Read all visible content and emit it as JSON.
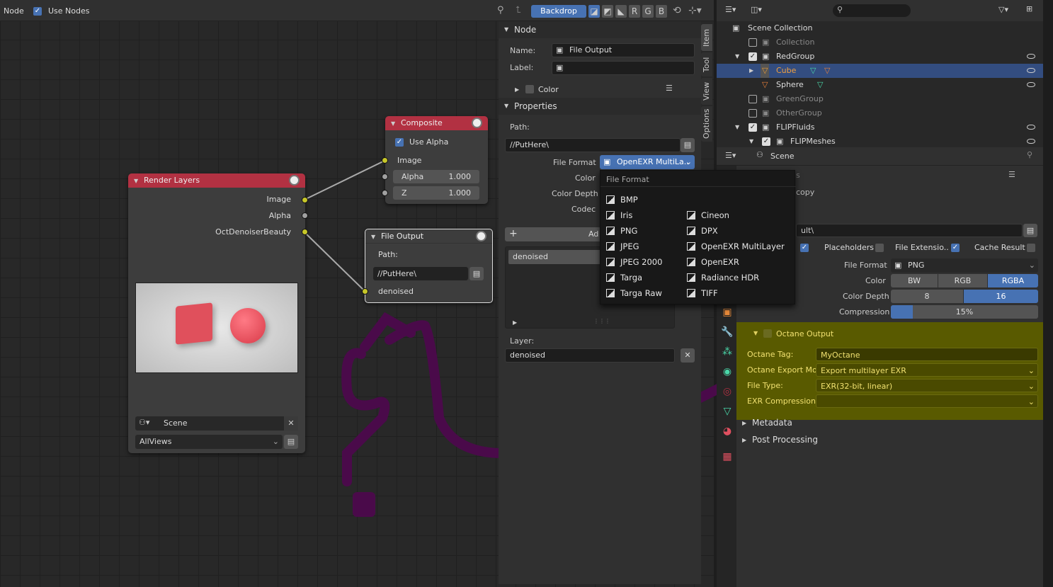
{
  "header": {
    "editor": "Node",
    "use_nodes": "Use Nodes",
    "backdrop": "Backdrop",
    "channels": [
      "R",
      "G",
      "B"
    ]
  },
  "render_layers": {
    "title": "Render Layers",
    "outputs": [
      "Image",
      "Alpha",
      "OctDenoiserBeauty"
    ],
    "scene": "Scene",
    "views": "AllViews"
  },
  "composite": {
    "title": "Composite",
    "use_alpha": "Use Alpha",
    "image": "Image",
    "alpha_label": "Alpha",
    "alpha_value": "1.000",
    "z_label": "Z",
    "z_value": "1.000"
  },
  "file_output_node": {
    "title": "File Output",
    "path_label": "Path:",
    "path": "//PutHere\\",
    "input": "denoised"
  },
  "npanel": {
    "node_section": "Node",
    "name_label": "Name:",
    "name_value": "File Output",
    "label_label": "Label:",
    "color_label": "Color",
    "properties_section": "Properties",
    "path_label": "Path:",
    "path": "//PutHere\\",
    "file_format_label": "File Format",
    "file_format_value": "OpenEXR MultiLa..",
    "color_label2": "Color",
    "color_depth_label": "Color Depth",
    "codec_label": "Codec",
    "add_input": "Ad",
    "slot": "denoised",
    "layer_label": "Layer:",
    "layer_value": "denoised",
    "tabs": [
      "Item",
      "Tool",
      "View",
      "Options"
    ]
  },
  "menu": {
    "title": "File Format",
    "left": [
      "BMP",
      "Iris",
      "PNG",
      "JPEG",
      "JPEG 2000",
      "Targa",
      "Targa Raw"
    ],
    "right": [
      "Cineon",
      "DPX",
      "OpenEXR MultiLayer",
      "OpenEXR",
      "Radiance HDR",
      "TIFF"
    ]
  },
  "outliner": {
    "rows": [
      {
        "name": "Scene Collection"
      },
      {
        "name": "Collection"
      },
      {
        "name": "RedGroup"
      },
      {
        "name": "Cube"
      },
      {
        "name": "Sphere"
      },
      {
        "name": "GreenGroup"
      },
      {
        "name": "OtherGroup"
      },
      {
        "name": "FLIPFluids"
      },
      {
        "name": "FLIPMeshes"
      }
    ]
  },
  "properties": {
    "scene": "Scene",
    "output_path": "ult\\",
    "placeholders": "Placeholders",
    "file_extensions": "File Extensio..",
    "cache_result": "Cache Result",
    "file_format_label": "File Format",
    "file_format": "PNG",
    "color_label": "Color",
    "color_options": [
      "BW",
      "RGB",
      "RGBA"
    ],
    "color_depth_label": "Color Depth",
    "depth_options": [
      "8",
      "16"
    ],
    "compression_label": "Compression",
    "compression": "15%",
    "octane_output": "Octane Output",
    "octane_tag_label": "Octane Tag:",
    "octane_tag": "MyOctane",
    "export_mode_label": "Octane Export Mo..",
    "export_mode": "Export multilayer EXR",
    "file_type_label": "File Type:",
    "file_type": "EXR(32-bit, linear)",
    "exr_compression_label": "EXR Compression:",
    "metadata": "Metadata",
    "post_processing": "Post Processing",
    "stereoscopy_partial": "copy",
    "dims_partial": "s"
  },
  "colors": {
    "accent": "#4772b3",
    "node_red": "#b23142",
    "socket": "#c7c729",
    "highlight": "#595a00",
    "scribble": "#4a0a4a"
  }
}
